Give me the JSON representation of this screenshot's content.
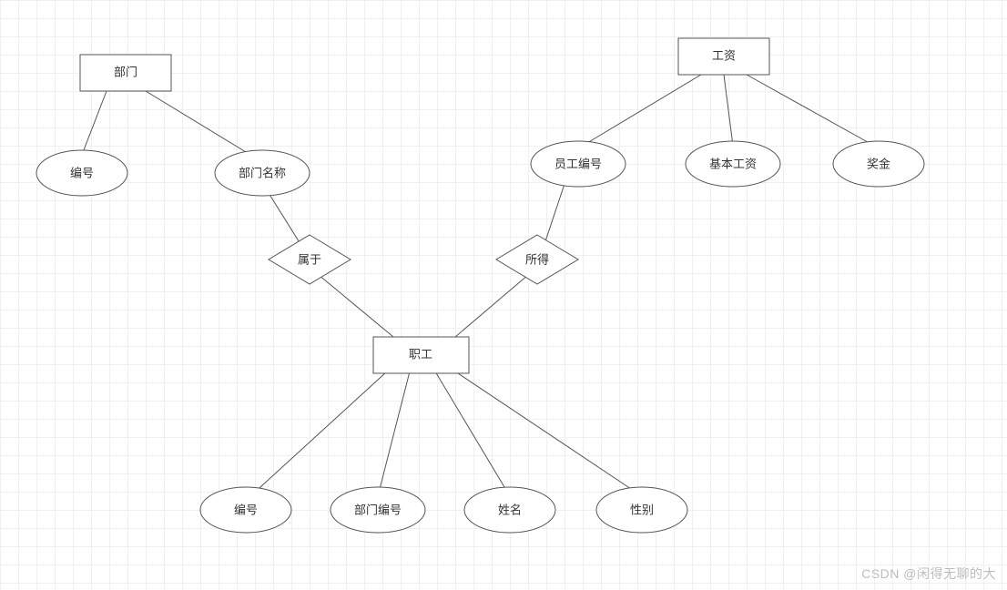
{
  "diagram": {
    "entities": {
      "department": {
        "label": "部门"
      },
      "salary": {
        "label": "工资"
      },
      "employee": {
        "label": "职工"
      }
    },
    "relationships": {
      "belongs_to": {
        "label": "属于"
      },
      "earns": {
        "label": "所得"
      }
    },
    "attributes": {
      "dept_id": {
        "label": "编号"
      },
      "dept_name": {
        "label": "部门名称"
      },
      "salary_emp_id": {
        "label": "员工编号"
      },
      "base_salary": {
        "label": "基本工资"
      },
      "bonus": {
        "label": "奖金"
      },
      "emp_id": {
        "label": "编号"
      },
      "emp_dept_id": {
        "label": "部门编号"
      },
      "emp_name": {
        "label": "姓名"
      },
      "emp_gender": {
        "label": "性别"
      }
    }
  },
  "watermark": "CSDN @闲得无聊的大"
}
